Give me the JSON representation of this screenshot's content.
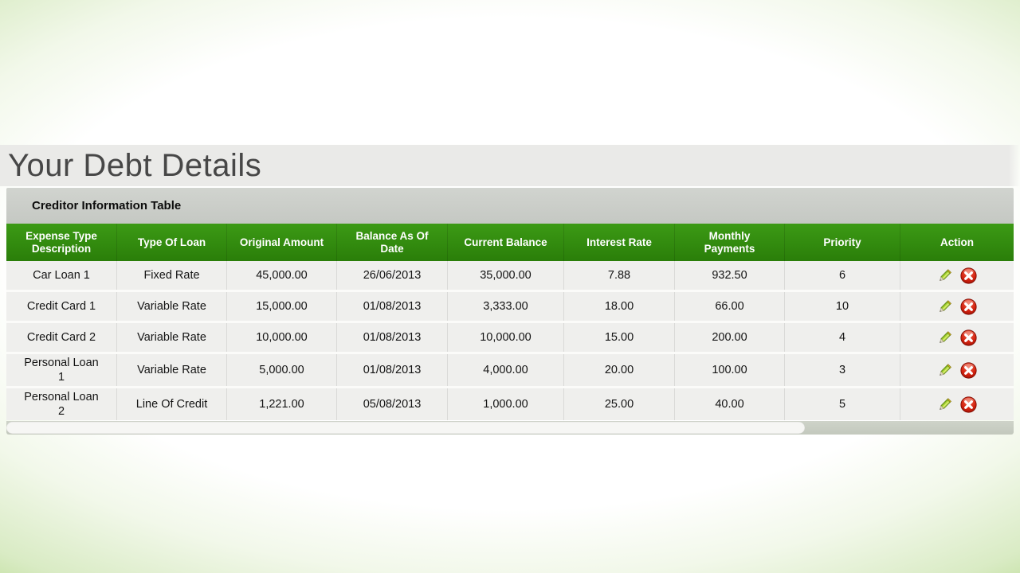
{
  "page": {
    "title": "Your Debt Details"
  },
  "table": {
    "caption": "Creditor Information Table",
    "columns": [
      "Expense Type Description",
      "Type Of Loan",
      "Original Amount",
      "Balance As Of Date",
      "Current Balance",
      "Interest Rate",
      "Monthly Payments",
      "Priority",
      "Action"
    ],
    "column_keys": [
      "expense",
      "loan_type",
      "original_amount",
      "balance_as_of",
      "current_balance",
      "interest_rate",
      "monthly_payments",
      "priority"
    ],
    "rows": [
      {
        "expense": "Car Loan 1",
        "loan_type": "Fixed Rate",
        "original_amount": "45,000.00",
        "balance_as_of": "26/06/2013",
        "current_balance": "35,000.00",
        "interest_rate": "7.88",
        "monthly_payments": "932.50",
        "priority": "6"
      },
      {
        "expense": "Credit Card 1",
        "loan_type": "Variable Rate",
        "original_amount": "15,000.00",
        "balance_as_of": "01/08/2013",
        "current_balance": "3,333.00",
        "interest_rate": "18.00",
        "monthly_payments": "66.00",
        "priority": "10"
      },
      {
        "expense": "Credit Card 2",
        "loan_type": "Variable Rate",
        "original_amount": "10,000.00",
        "balance_as_of": "01/08/2013",
        "current_balance": "10,000.00",
        "interest_rate": "15.00",
        "monthly_payments": "200.00",
        "priority": "4"
      },
      {
        "expense": "Personal Loan 1",
        "loan_type": "Variable Rate",
        "original_amount": "5,000.00",
        "balance_as_of": "01/08/2013",
        "current_balance": "4,000.00",
        "interest_rate": "20.00",
        "monthly_payments": "100.00",
        "priority": "3"
      },
      {
        "expense": "Personal Loan 2",
        "loan_type": "Line Of Credit",
        "original_amount": "1,221.00",
        "balance_as_of": "05/08/2013",
        "current_balance": "1,000.00",
        "interest_rate": "25.00",
        "monthly_payments": "40.00",
        "priority": "5"
      }
    ],
    "action_icons": [
      {
        "name": "pencil-icon",
        "meaning": "edit row"
      },
      {
        "name": "delete-icon",
        "meaning": "delete row"
      }
    ]
  },
  "colors": {
    "header_green": "#2f8a0f",
    "caption_gray": "#c9ccc7",
    "row_gray": "#efefed",
    "background_green_edge": "#aed681",
    "delete_red": "#c01000",
    "pencil_green": "#9acd32"
  }
}
